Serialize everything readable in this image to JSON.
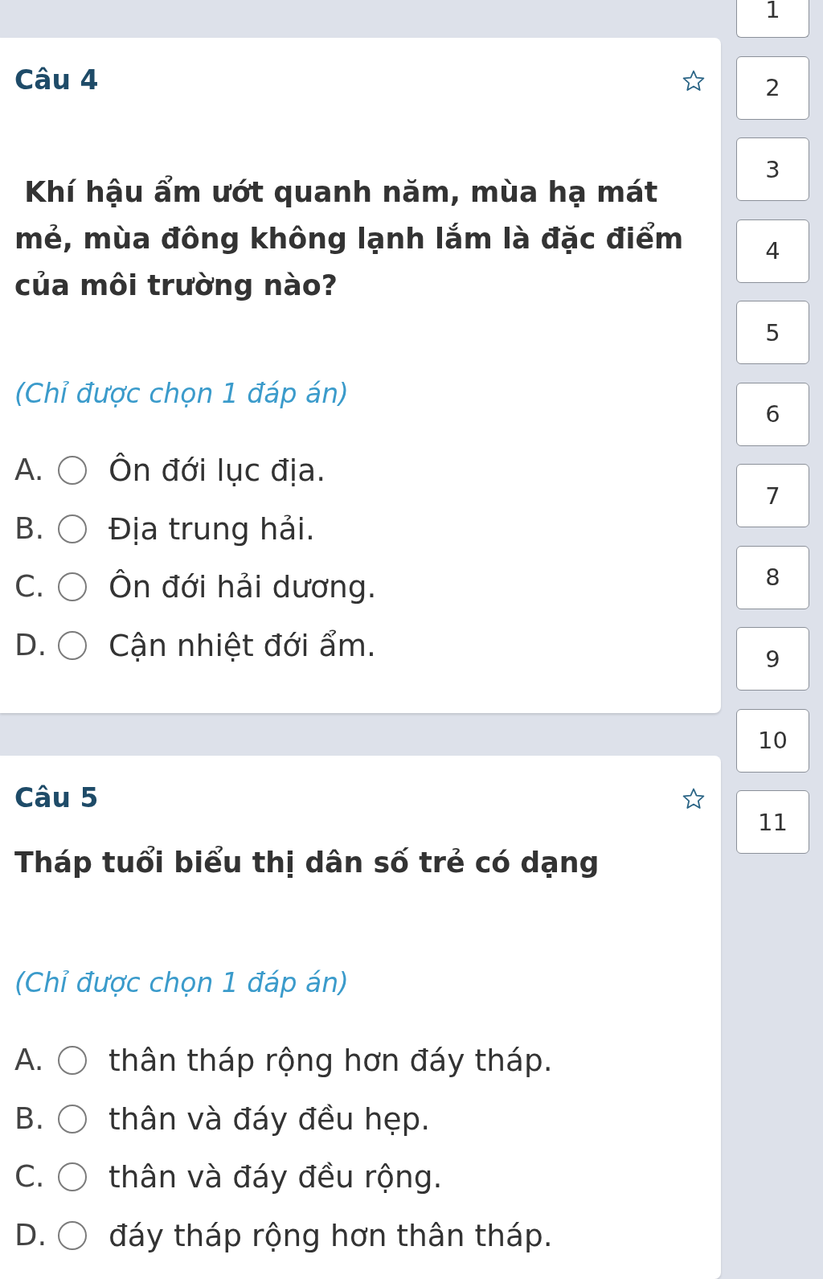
{
  "questions": [
    {
      "title": "Câu 4",
      "flagged": false,
      "text": " Khí hậu ẩm ướt quanh năm, mùa hạ mát mẻ, mùa đông không lạnh lắm là đặc điểm của môi trường nào?",
      "hint": "(Chỉ được chọn 1 đáp án)",
      "options": [
        {
          "letter": "A.",
          "text": "Ôn đới lục địa.",
          "selected": false
        },
        {
          "letter": "B.",
          "text": "Địa trung hải.",
          "selected": false
        },
        {
          "letter": "C.",
          "text": "Ôn đới hải dương.",
          "selected": false
        },
        {
          "letter": "D.",
          "text": "Cận nhiệt đới ẩm.",
          "selected": false
        }
      ]
    },
    {
      "title": "Câu 5",
      "flagged": false,
      "text": "Tháp tuổi biểu thị dân số trẻ có dạng",
      "hint": "(Chỉ được chọn 1 đáp án)",
      "options": [
        {
          "letter": "A.",
          "text": "thân tháp rộng hơn đáy tháp.",
          "selected": false
        },
        {
          "letter": "B.",
          "text": "thân và đáy đều hẹp.",
          "selected": false
        },
        {
          "letter": "C.",
          "text": "thân và đáy đều rộng.",
          "selected": false
        },
        {
          "letter": "D.",
          "text": "đáy tháp rộng hơn thân tháp.",
          "selected": false
        }
      ]
    }
  ],
  "question_nav": [
    "1",
    "2",
    "3",
    "4",
    "5",
    "6",
    "7",
    "8",
    "9",
    "10",
    "11"
  ]
}
